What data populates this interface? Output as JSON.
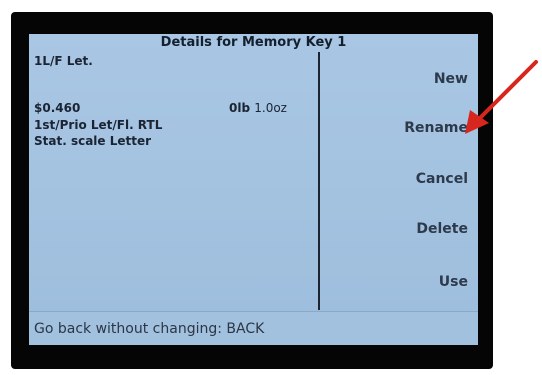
{
  "screen": {
    "title": "Details for Memory Key 1"
  },
  "details": {
    "line1": "1L/F Let.",
    "amount": "$0.460",
    "weight_lb": "0lb",
    "weight_oz": "1.0oz",
    "service": "1st/Prio Let/Fl. RTL",
    "scale": "Stat. scale Letter"
  },
  "actions": {
    "new": "New",
    "rename": "Rename",
    "cancel": "Cancel",
    "delete": "Delete",
    "use": "Use"
  },
  "status": {
    "hint": "Go back without changing: BACK"
  },
  "colors": {
    "screen_bg": "#a4c3e1",
    "bezel": "#050505",
    "annotation_arrow": "#d7261e"
  }
}
